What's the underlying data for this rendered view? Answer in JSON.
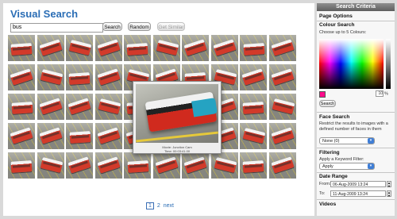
{
  "header": {
    "title": "Visual Search"
  },
  "search": {
    "value": "bus",
    "search_label": "Search",
    "random_label": "Random",
    "similar_label": "Get Similar"
  },
  "results": {
    "rows": 5,
    "cols": 10
  },
  "preview": {
    "caption_line1": "Movie: Junction Cam",
    "caption_line2": "Time: 00:03:41.00"
  },
  "pagination": {
    "current": "1",
    "page2": "2",
    "next": "next"
  },
  "panel": {
    "header": "Search Criteria",
    "page_options": "Page Options",
    "colour": {
      "title": "Colour Search",
      "hint": "Choose up to 5 Colours:",
      "percent_value": "10",
      "percent_unit": "%",
      "search_label": "Search",
      "selected_color": "#ff0a8c"
    },
    "face": {
      "title": "Face Search",
      "hint": "Restrict the results to images with a defined number of faces in them",
      "selected": "None (0)"
    },
    "filtering": {
      "title": "Filtering",
      "hint": "Apply a Keyword Filter:",
      "selected": "Apply"
    },
    "date_range": {
      "title": "Date Range",
      "from_label": "From:",
      "from_value": "06-Aug-2009 13:24",
      "to_label": "To:",
      "to_value": "11-Aug-2009 13:24"
    },
    "videos": {
      "title": "Videos"
    }
  }
}
